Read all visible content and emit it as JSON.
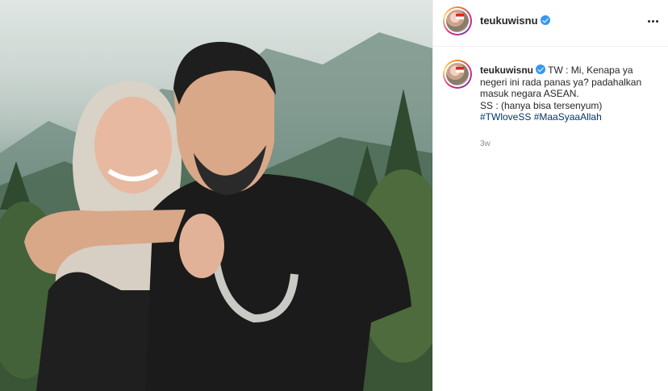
{
  "post": {
    "username": "teukuwisnu",
    "verified_icon": "verified-badge-icon",
    "more_icon": "more-options-icon",
    "caption": {
      "line1": "TW : Mi, Kenapa ya",
      "line2": "negeri ini rada panas ya? padahalkan",
      "line3": "masuk negara ASEAN.",
      "line4": "SS : (hanya bisa tersenyum)",
      "hashtag1": "#TWloveSS",
      "hashtag2": "#MaaSyaaAllah"
    },
    "timestamp": "3w"
  },
  "colors": {
    "hashtag": "#00376b",
    "verified": "#3897f0",
    "muted": "#8e8e8e",
    "text": "#262626"
  }
}
